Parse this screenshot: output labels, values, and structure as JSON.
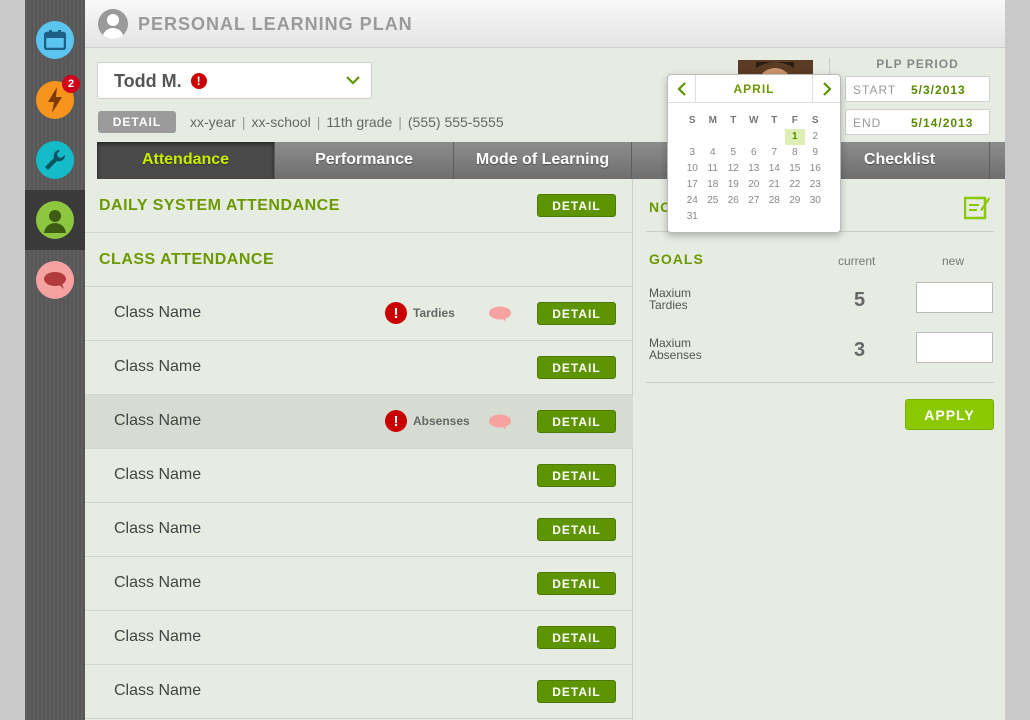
{
  "sidebar": {
    "badge_count": "2",
    "items": [
      {
        "icon": "calendar-icon",
        "color": "#5bc4ef"
      },
      {
        "icon": "lightning-icon",
        "color": "#f7941d"
      },
      {
        "icon": "wrench-icon",
        "color": "#13bcc8"
      },
      {
        "icon": "person-icon",
        "color": "#8dc63f"
      },
      {
        "icon": "speech-bubble-icon",
        "color": "#f7a1a1"
      }
    ]
  },
  "header": {
    "title": "PERSONAL LEARNING PLAN"
  },
  "student": {
    "name": "Todd M.",
    "alert_glyph": "!",
    "detail_label": "DETAIL",
    "year": "xx-year",
    "school": "xx-school",
    "grade": "11th grade",
    "phone": "(555) 555-5555",
    "separator": "|"
  },
  "plp_period": {
    "title": "PLP PERIOD",
    "start_label": "START",
    "start_value": "5/3/2013",
    "end_label": "END",
    "end_value": "5/14/2013"
  },
  "tabs": [
    "Attendance",
    "Performance",
    "Mode of Learning",
    "",
    "Checklist"
  ],
  "attendance": {
    "daily_title": "DAILY SYSTEM ATTENDANCE",
    "class_title": "CLASS ATTENDANCE",
    "detail_label": "DETAIL",
    "classes": [
      {
        "name": "Class Name",
        "flag": "Tardies"
      },
      {
        "name": "Class Name",
        "flag": ""
      },
      {
        "name": "Class Name",
        "flag": "Absenses"
      },
      {
        "name": "Class Name",
        "flag": ""
      },
      {
        "name": "Class Name",
        "flag": ""
      },
      {
        "name": "Class Name",
        "flag": ""
      },
      {
        "name": "Class Name",
        "flag": ""
      },
      {
        "name": "Class Name",
        "flag": ""
      }
    ]
  },
  "notes": {
    "title": "NO"
  },
  "goals": {
    "title": "GOALS",
    "col_current": "current",
    "col_new": "new",
    "items": [
      {
        "label_line1": "Maxium",
        "label_line2": "Tardies",
        "current": "5",
        "new": ""
      },
      {
        "label_line1": "Maxium",
        "label_line2": "Absenses",
        "current": "3",
        "new": ""
      }
    ],
    "apply_label": "APPLY"
  },
  "calendar": {
    "month": "APRIL",
    "weekdays": [
      "S",
      "M",
      "T",
      "W",
      "T",
      "F",
      "S"
    ],
    "weeks": [
      [
        "",
        "",
        "",
        "",
        "",
        "1",
        "2"
      ],
      [
        "3",
        "4",
        "5",
        "6",
        "7",
        "8",
        "9"
      ],
      [
        "10",
        "11",
        "12",
        "13",
        "14",
        "15",
        "16"
      ],
      [
        "17",
        "18",
        "19",
        "20",
        "21",
        "22",
        "23"
      ],
      [
        "24",
        "25",
        "26",
        "27",
        "28",
        "29",
        "30"
      ],
      [
        "31",
        "",
        "",
        "",
        "",
        "",
        ""
      ]
    ],
    "selected_day": "1"
  },
  "colors": {
    "accent_green": "#6d9900",
    "button_green": "#5e9400",
    "apply_green": "#8cc800",
    "alert_red": "#c80000"
  }
}
